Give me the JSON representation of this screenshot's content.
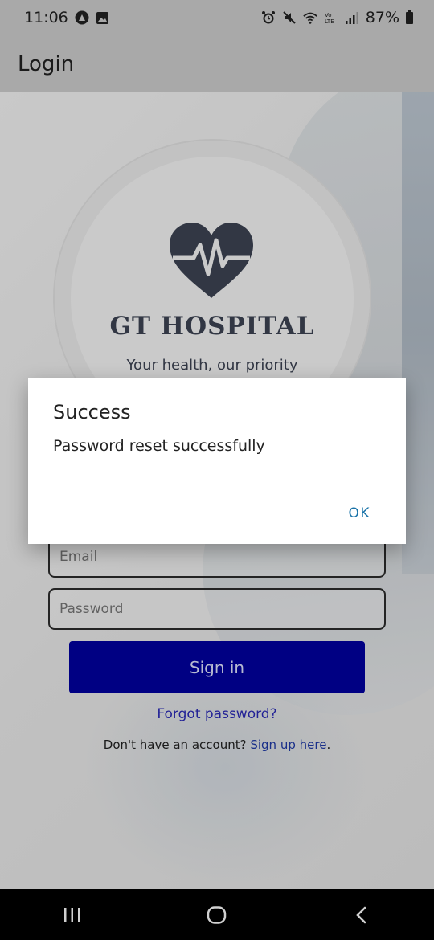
{
  "status_bar": {
    "time": "11:06",
    "battery": "87%",
    "icons": [
      "app-notification-icon",
      "gallery-icon",
      "alarm-icon",
      "mute-icon",
      "wifi-icon",
      "volte-icon",
      "signal-icon",
      "battery-icon"
    ]
  },
  "app_bar": {
    "title": "Login"
  },
  "brand": {
    "name": "GT HOSPITAL",
    "tagline": "Your health, our priority",
    "logo_icon": "heart-pulse-icon",
    "logo_color": "#3d4454"
  },
  "form": {
    "email_placeholder": "Email",
    "password_placeholder": "Password",
    "signin_label": "Sign in",
    "forgot_label": "Forgot password?",
    "signup_prompt": "Don't have an account?",
    "signup_link": "Sign up here",
    "signup_suffix": "."
  },
  "dialog": {
    "title": "Success",
    "message": "Password reset successfully",
    "ok_label": "OK"
  },
  "nav_bar": {
    "icons": [
      "recent-apps-icon",
      "home-icon",
      "back-icon"
    ]
  },
  "colors": {
    "signin_button": "#0000a0",
    "link": "#2a2ab8",
    "dialog_action": "#1a73a8",
    "nav_bar": "#000000"
  }
}
